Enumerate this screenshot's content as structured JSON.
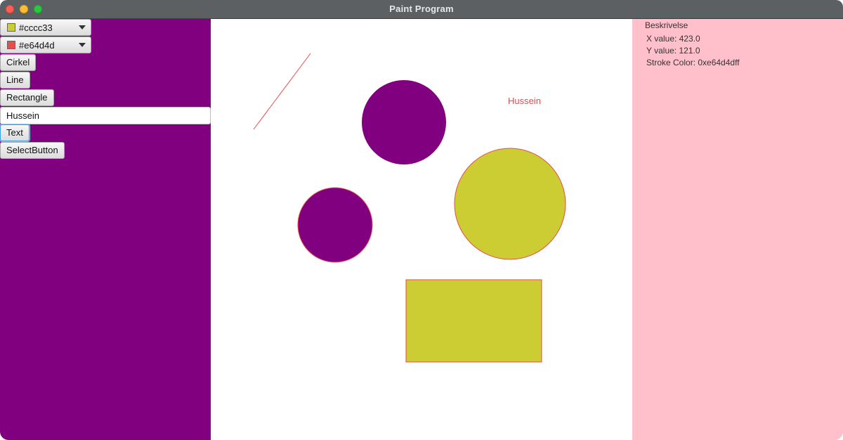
{
  "window": {
    "title": "Paint Program"
  },
  "toolbar": {
    "fill_picker": {
      "value": "#cccc33",
      "swatch_color": "#cccc33"
    },
    "stroke_picker": {
      "value": "#e64d4d",
      "swatch_color": "#e64d4d"
    },
    "buttons": {
      "circle": "Cirkel",
      "line": "Line",
      "rectangle": "Rectangle",
      "text": "Text",
      "select": "SelectButton"
    },
    "text_input_value": "Hussein"
  },
  "info_panel": {
    "title": "Beskrivelse",
    "x_value": "X value: 423.0",
    "y_value": "Y value: 121.0",
    "stroke_color": "Stroke Color: 0xe64d4dff"
  },
  "canvas": {
    "text_shape": "Hussein",
    "colors": {
      "left_panel": "#800080",
      "right_panel": "#ffc0cb",
      "fill_yellow": "#cccc33",
      "stroke_red": "#e64d4d",
      "purple": "#800080"
    }
  }
}
